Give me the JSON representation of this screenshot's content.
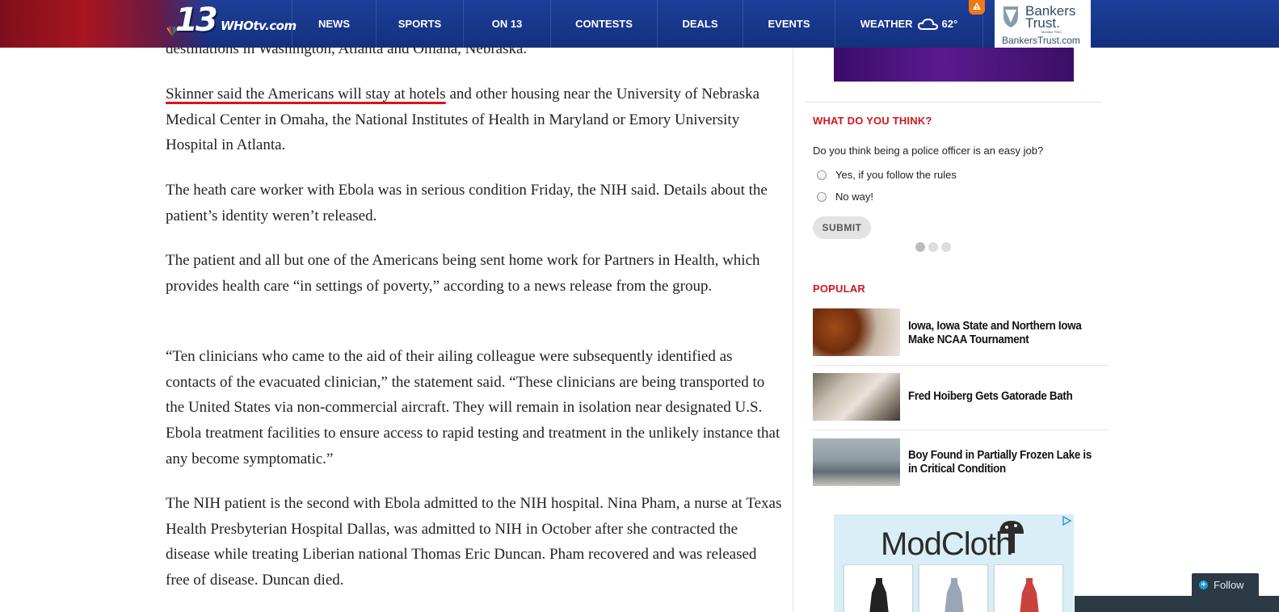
{
  "header": {
    "logo": {
      "number": "13",
      "brand": "WHOtv.com"
    },
    "nav": [
      "NEWS",
      "SPORTS",
      "ON 13",
      "CONTESTS",
      "DEALS",
      "EVENTS"
    ],
    "weather": {
      "label": "WEATHER",
      "temp": "62°"
    },
    "ad": {
      "name_line1": "Bankers",
      "name_line2": "Trust.",
      "small": "Member FDIC",
      "url": "BankersTrust.com"
    }
  },
  "article": {
    "p0": "destinations in Washington, Atlanta and Omaha, Nebraska.",
    "p1_highlight": "Skinner said the Americans will stay at hotels",
    "p1_rest": " and other housing near the University of Nebraska Medical Center in Omaha, the National Institutes of Health in Maryland or Emory University Hospital in Atlanta.",
    "p2": "The heath care worker with Ebola was in serious condition Friday, the NIH said. Details about the patient’s identity weren’t released.",
    "p3": "The patient and all but one of the Americans being sent home work for Partners in Health, which provides health care “in settings of poverty,” according to a news release from the group.",
    "p4": "“Ten clinicians who came to the aid of their ailing colleague were subsequently identified as contacts of the evacuated clinician,” the statement said. “These clinicians are being transported to the United States via non-commercial aircraft. They will remain in isolation near designated U.S. Ebola treatment facilities to ensure access to rapid testing and treatment in the unlikely instance that any become symptomatic.”",
    "p5": "The NIH patient is the second with Ebola admitted to the NIH hospital. Nina Pham, a nurse at Texas Health Presbyterian Hospital Dallas, was admitted to NIH in October after she contracted the disease while treating Liberian national Thomas Eric Duncan. Pham recovered and was released free of disease. Duncan died."
  },
  "poll": {
    "heading": "WHAT DO YOU THINK?",
    "question": "Do you think being a police officer is an easy job?",
    "options": [
      "Yes, if you follow the rules",
      "No way!"
    ],
    "submit": "SUBMIT",
    "page_count": 3,
    "active_page": 1
  },
  "popular": {
    "heading": "POPULAR",
    "items": [
      {
        "title": "Iowa, Iowa State and Northern Iowa Make NCAA Tournament"
      },
      {
        "title": "Fred Hoiberg Gets Gatorade Bath"
      },
      {
        "title": "Boy Found in Partially Frozen Lake is in Critical Condition"
      }
    ]
  },
  "ad_bottom": {
    "brand": "ModCloth"
  },
  "follow": {
    "label": "Follow"
  },
  "colors": {
    "header_blue": "#1c3f9a",
    "accent_red": "#d0181f",
    "highlight_underline": "#e0101a"
  }
}
